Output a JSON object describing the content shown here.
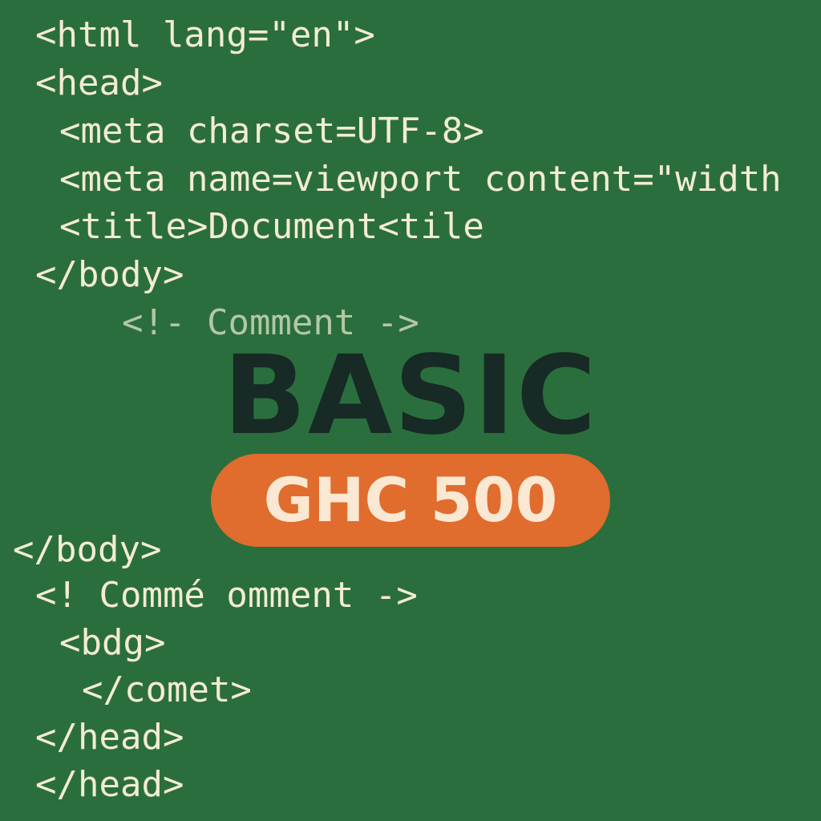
{
  "code_lines": [
    {
      "text": "<html lang=\"en\">"
    },
    {
      "text": "<head>"
    },
    {
      "text": "<meta charset=UTF-8>"
    },
    {
      "text": "<meta name=viewport content=\"width"
    },
    {
      "text": "<title>Document<tile"
    },
    {
      "text": "</body>"
    },
    {
      "text": "<!- Comment ->"
    },
    {
      "text": "</body>"
    },
    {
      "text": "<! Commé omment ->"
    },
    {
      "text": "<bdg>"
    },
    {
      "text": "</comet>"
    },
    {
      "text": "</head>"
    },
    {
      "text": "</head>"
    }
  ],
  "title": "BASIC",
  "price_badge": "GHC 500",
  "colors": {
    "background": "#2b6e3d",
    "code_text": "#f2ecd2",
    "comment_text": "#b3c7a6",
    "title_text": "#172a26",
    "badge_background": "#e06c2e",
    "badge_text": "#fbe8d2"
  }
}
